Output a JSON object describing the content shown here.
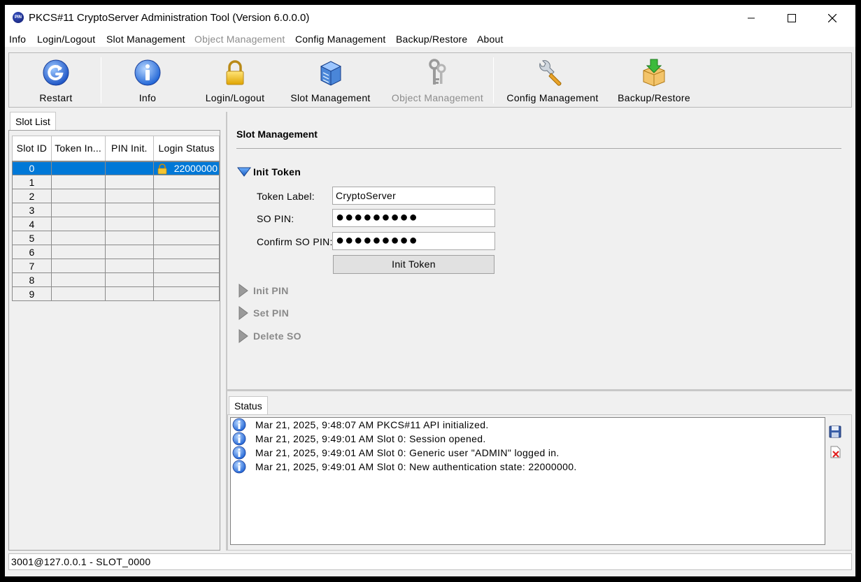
{
  "window": {
    "title": "PKCS#11 CryptoServer Administration Tool (Version 6.0.0.0)",
    "app_icon_text": "PIN",
    "minimize_glyph": "─",
    "maximize_glyph": "☐",
    "close_glyph": "✕"
  },
  "menu": {
    "items": [
      {
        "label": "Info",
        "enabled": true
      },
      {
        "label": "Login/Logout",
        "enabled": true
      },
      {
        "label": "Slot Management",
        "enabled": true
      },
      {
        "label": "Object Management",
        "enabled": false
      },
      {
        "label": "Config Management",
        "enabled": true
      },
      {
        "label": "Backup/Restore",
        "enabled": true
      },
      {
        "label": "About",
        "enabled": true
      }
    ]
  },
  "toolbar": {
    "buttons": [
      {
        "label": "Restart",
        "icon": "restart-icon",
        "enabled": true
      },
      {
        "label": "Info",
        "icon": "info-icon",
        "enabled": true
      },
      {
        "label": "Login/Logout",
        "icon": "padlock-icon",
        "enabled": true
      },
      {
        "label": "Slot Management",
        "icon": "server-icon",
        "enabled": true
      },
      {
        "label": "Object Management",
        "icon": "keys-icon",
        "enabled": false
      },
      {
        "label": "Config Management",
        "icon": "wrench-icon",
        "enabled": true
      },
      {
        "label": "Backup/Restore",
        "icon": "backup-box-icon",
        "enabled": true
      }
    ]
  },
  "slot_list": {
    "tab_label": "Slot List",
    "columns": [
      "Slot ID",
      "Token In...",
      "PIN Init.",
      "Login Status"
    ],
    "rows": [
      {
        "slot_id": "0",
        "token_init": "",
        "pin_init": "",
        "login_status": "22000000",
        "selected": true,
        "locked": true
      },
      {
        "slot_id": "1",
        "token_init": "",
        "pin_init": "",
        "login_status": ""
      },
      {
        "slot_id": "2",
        "token_init": "",
        "pin_init": "",
        "login_status": ""
      },
      {
        "slot_id": "3",
        "token_init": "",
        "pin_init": "",
        "login_status": ""
      },
      {
        "slot_id": "4",
        "token_init": "",
        "pin_init": "",
        "login_status": ""
      },
      {
        "slot_id": "5",
        "token_init": "",
        "pin_init": "",
        "login_status": ""
      },
      {
        "slot_id": "6",
        "token_init": "",
        "pin_init": "",
        "login_status": ""
      },
      {
        "slot_id": "7",
        "token_init": "",
        "pin_init": "",
        "login_status": ""
      },
      {
        "slot_id": "8",
        "token_init": "",
        "pin_init": "",
        "login_status": ""
      },
      {
        "slot_id": "9",
        "token_init": "",
        "pin_init": "",
        "login_status": ""
      }
    ]
  },
  "slot_management": {
    "title": "Slot Management",
    "init_token": {
      "header": "Init Token",
      "expanded": true,
      "token_label_label": "Token Label:",
      "token_label_value": "CryptoServer",
      "so_pin_label": "SO PIN:",
      "so_pin_value": "●●●●●●●●●",
      "confirm_so_pin_label": "Confirm SO PIN:",
      "confirm_so_pin_value": "●●●●●●●●●",
      "button_label": "Init Token"
    },
    "collapsed_groups": [
      {
        "label": "Init PIN"
      },
      {
        "label": "Set PIN"
      },
      {
        "label": "Delete SO"
      }
    ]
  },
  "status": {
    "tab_label": "Status",
    "entries": [
      {
        "text": "Mar 21, 2025, 9:48:07 AM PKCS#11 API initialized."
      },
      {
        "text": "Mar 21, 2025, 9:49:01 AM Slot 0: Session opened."
      },
      {
        "text": "Mar 21, 2025, 9:49:01 AM Slot 0: Generic user \"ADMIN\" logged in."
      },
      {
        "text": "Mar 21, 2025, 9:49:01 AM Slot 0: New authentication state: 22000000."
      }
    ]
  },
  "statusbar": {
    "connection": "3001@127.0.0.1 - SLOT_0000"
  },
  "colors": {
    "selection": "#0078d7",
    "disabled_text": "#8c8c8c",
    "background": "#f0f0f0"
  }
}
